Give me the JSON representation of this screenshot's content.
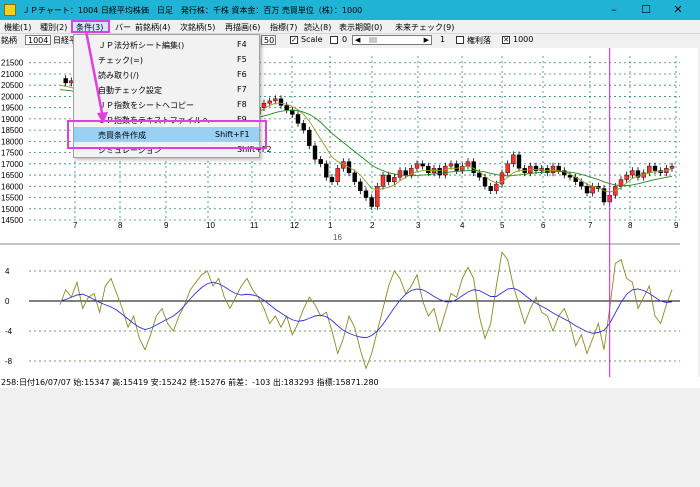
{
  "window": {
    "title": "ＪＰチャート：1004 日経平均株価　日足　発行株：千株 資本金：百万 売買単位（株）：1000",
    "minimize_glyph": "–",
    "maximize_glyph": "☐",
    "close_glyph": "✕"
  },
  "menubar": {
    "items": [
      "機能(1)",
      "種別(2)",
      "条件(3)",
      "バー",
      "前銘柄(4)",
      "次銘柄(5)",
      "再描画(6)",
      "指標(7)",
      "読込(8)",
      "表示期間(0)",
      "未来チェック(9)"
    ]
  },
  "toolbar": {
    "code_label": "銘柄",
    "code_value": "1004",
    "name_value": "日経平",
    "span_value": "50",
    "scale_label": "Scale",
    "scale_value": "0",
    "page_value": "1",
    "log_label": "権利落",
    "thousand_label": "1000",
    "scale_checked": "✓",
    "thousand_checked": "✕"
  },
  "dropdown": {
    "items": [
      {
        "label": "ＪＰ法分析シート編集()",
        "shortcut": "F4"
      },
      {
        "label": "チェック(=)",
        "shortcut": "F5"
      },
      {
        "label": "読み取り(/)",
        "shortcut": "F6"
      },
      {
        "label": "自動チェック設定",
        "shortcut": "F7"
      },
      {
        "label": "ＪＰ指数をシートへコピー",
        "shortcut": "F8"
      },
      {
        "label": "ＪＰ指数をテキストファイルへ",
        "shortcut": "F9"
      },
      {
        "label": "売買条件作成",
        "shortcut": "Shift+F1"
      },
      {
        "label": "シミュレーション",
        "shortcut": "Shift+F2"
      }
    ],
    "selected_index": 6
  },
  "status": {
    "text": "258:日付16/07/07 始:15347 高:15419 安:15242 終:15276 前差：-103 出:183293 指標:15871.280"
  },
  "chart_data": [
    {
      "type": "candlestick",
      "ylim": [
        14500,
        21800
      ],
      "y_ticks": [
        21500,
        21000,
        20500,
        20000,
        19500,
        19000,
        18500,
        18000,
        17500,
        17000,
        16500,
        16000,
        15500,
        15000,
        14500
      ],
      "x_ticks": [
        "7",
        "8",
        "9",
        "10",
        "11",
        "12",
        "1",
        "2",
        "3",
        "4",
        "5",
        "6",
        "7",
        "8",
        "9"
      ],
      "x_year_label": "16",
      "grid": true,
      "close_series": [
        20800,
        20600,
        20700,
        20300,
        20500,
        20100,
        20300,
        19900,
        20200,
        19700,
        19900,
        19800,
        19300,
        19100,
        19400,
        19200,
        18700,
        18500,
        18800,
        18200,
        17800,
        18300,
        18500,
        18800,
        18400,
        19000,
        19200,
        19100,
        18900,
        18700,
        18500,
        18900,
        19100,
        19300,
        19200,
        19500,
        19700,
        19800,
        19900,
        19600,
        19400,
        19200,
        18800,
        18500,
        17800,
        17200,
        17000,
        16400,
        16200,
        16800,
        17100,
        16600,
        16200,
        15800,
        15500,
        15100,
        16000,
        16500,
        16200,
        16400,
        16700,
        16500,
        16800,
        17000,
        16900,
        16600,
        16800,
        16500,
        16900,
        17000,
        16700,
        16900,
        17100,
        16600,
        16400,
        16000,
        15800,
        16100,
        16600,
        17000,
        17400,
        16800,
        16600,
        16900,
        16700,
        16800,
        16600,
        16900,
        16700,
        16500,
        16400,
        16200,
        16000,
        15700,
        16000,
        15900,
        15300,
        15600,
        16000,
        16300,
        16500,
        16700,
        16400,
        16600,
        16900,
        16700,
        16600,
        16800,
        16900
      ],
      "ma_short": [
        20500,
        20450,
        20400,
        20300,
        20250,
        20200,
        20100,
        20000,
        19950,
        19850,
        19750,
        19650,
        19500,
        19350,
        19250,
        19100,
        18950,
        18850,
        18750,
        18650,
        18550,
        18550,
        18600,
        18650,
        18700,
        18800,
        18900,
        18950,
        19000,
        18950,
        18900,
        18950,
        19000,
        19100,
        19200,
        19300,
        19450,
        19600,
        19700,
        19700,
        19650,
        19550,
        19400,
        19200,
        18900,
        18500,
        18100,
        17700,
        17300,
        17100,
        17000,
        16850,
        16700,
        16500,
        16200,
        15900,
        15850,
        15900,
        15950,
        16050,
        16250,
        16400,
        16550,
        16650,
        16700,
        16700,
        16700,
        16700,
        16750,
        16800,
        16800,
        16850,
        16900,
        16800,
        16650,
        16450,
        16250,
        16150,
        16200,
        16400,
        16600,
        16700,
        16700,
        16750,
        16750,
        16750,
        16700,
        16700,
        16700,
        16650,
        16550,
        16400,
        16250,
        16100,
        16000,
        15950,
        15800,
        15750,
        15800,
        15950,
        16150,
        16350,
        16450,
        16500,
        16600,
        16650,
        16650,
        16700,
        16750
      ],
      "ma_long": [
        20300,
        20280,
        20250,
        20200,
        20150,
        20100,
        20050,
        20000,
        19950,
        19900,
        19850,
        19780,
        19700,
        19600,
        19500,
        19400,
        19300,
        19200,
        19100,
        19000,
        18900,
        18850,
        18800,
        18780,
        18760,
        18760,
        18780,
        18800,
        18820,
        18830,
        18840,
        18860,
        18900,
        18950,
        19000,
        19060,
        19130,
        19200,
        19280,
        19340,
        19380,
        19390,
        19370,
        19300,
        19200,
        19050,
        18850,
        18600,
        18350,
        18150,
        17950,
        17750,
        17550,
        17350,
        17150,
        16950,
        16800,
        16700,
        16600,
        16550,
        16500,
        16480,
        16470,
        16480,
        16500,
        16520,
        16550,
        16580,
        16610,
        16640,
        16660,
        16680,
        16700,
        16700,
        16680,
        16640,
        16580,
        16520,
        16480,
        16460,
        16480,
        16510,
        16540,
        16570,
        16600,
        16620,
        16640,
        16650,
        16660,
        16650,
        16630,
        16590,
        16530,
        16460,
        16380,
        16300,
        16200,
        16120,
        16060,
        16030,
        16030,
        16060,
        16110,
        16170,
        16240,
        16300,
        16350,
        16400,
        16440
      ],
      "marker_index": 97
    },
    {
      "type": "line",
      "ylim": [
        -10,
        6
      ],
      "y_ticks": [
        4,
        0,
        -4,
        -8
      ],
      "grid": true,
      "series": [
        {
          "values": [
            -0.5,
            1.5,
            0.5,
            2.5,
            -1.0,
            0.5,
            1.0,
            -1.5,
            2.0,
            3.0,
            1.0,
            -1.0,
            -3.5,
            -2.0,
            -5.0,
            -6.5,
            -4.5,
            -2.0,
            -1.0,
            -3.0,
            -4.0,
            -2.0,
            -0.5,
            1.5,
            2.5,
            3.5,
            4.0,
            2.0,
            3.0,
            0.5,
            -1.0,
            0.5,
            2.0,
            3.0,
            1.5,
            0.5,
            -1.0,
            -3.0,
            -2.0,
            -3.5,
            -2.0,
            -4.5,
            -3.0,
            -1.0,
            0.5,
            -0.5,
            -2.0,
            -1.5,
            -4.0,
            -7.0,
            -5.0,
            -2.0,
            -3.5,
            -6.5,
            -9.0,
            -7.0,
            -4.0,
            -1.0,
            2.0,
            4.0,
            3.0,
            1.0,
            2.0,
            3.5,
            0.0,
            -2.0,
            -1.0,
            -4.0,
            -1.5,
            1.0,
            0.5,
            3.0,
            4.5,
            3.0,
            -2.0,
            -5.0,
            -3.0,
            2.0,
            6.5,
            5.5,
            2.0,
            -0.5,
            -3.0,
            -1.0,
            0.5,
            -1.5,
            -2.0,
            -4.0,
            -2.0,
            -1.0,
            -3.0,
            -6.0,
            -4.5,
            -7.0,
            -5.0,
            -3.0,
            -6.5,
            -1.0,
            5.0,
            5.5,
            3.0,
            2.5,
            -1.0,
            0.5,
            2.0,
            -2.0,
            -3.0,
            -0.5,
            1.5
          ]
        },
        {
          "values": [
            0.0,
            0.2,
            0.5,
            0.8,
            0.9,
            0.6,
            0.2,
            -0.2,
            -0.5,
            -0.8,
            -1.2,
            -1.8,
            -2.4,
            -3.0,
            -3.5,
            -3.8,
            -3.6,
            -3.2,
            -2.8,
            -2.4,
            -2.0,
            -1.4,
            -0.6,
            0.3,
            1.1,
            1.8,
            2.3,
            2.5,
            2.3,
            1.9,
            1.4,
            1.0,
            0.8,
            0.9,
            0.8,
            0.6,
            0.1,
            -0.5,
            -1.1,
            -1.6,
            -2.1,
            -2.5,
            -2.7,
            -2.6,
            -2.3,
            -2.0,
            -1.9,
            -2.1,
            -2.6,
            -3.3,
            -3.9,
            -4.3,
            -4.6,
            -4.8,
            -4.9,
            -4.6,
            -4.0,
            -3.1,
            -2.0,
            -0.9,
            0.1,
            0.9,
            1.4,
            1.6,
            1.5,
            1.1,
            0.6,
            0.2,
            -0.1,
            -0.1,
            0.2,
            0.7,
            1.2,
            1.5,
            1.4,
            1.0,
            0.6,
            0.6,
            1.1,
            1.6,
            1.7,
            1.4,
            0.8,
            0.2,
            -0.3,
            -0.7,
            -1.1,
            -1.6,
            -2.0,
            -2.4,
            -2.8,
            -3.3,
            -3.7,
            -4.1,
            -4.3,
            -4.2,
            -3.9,
            -3.0,
            -1.6,
            -0.2,
            0.9,
            1.5,
            1.6,
            1.4,
            1.0,
            0.5,
            0.0,
            -0.2,
            -0.1
          ]
        }
      ],
      "colors": {
        "osc": "#8a8a20",
        "signal": "#3030e0"
      },
      "marker_index": 97
    }
  ]
}
